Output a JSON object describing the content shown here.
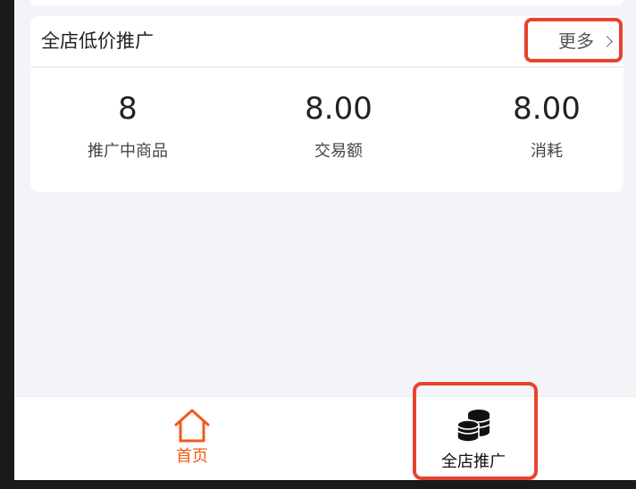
{
  "card": {
    "title": "全店低价推广",
    "more_label": "更多"
  },
  "stats": [
    {
      "value": "8",
      "label": "推广中商品"
    },
    {
      "value": "8.00",
      "label": "交易额"
    },
    {
      "value": "8.00",
      "label": "消耗"
    }
  ],
  "tabbar": {
    "home_label": "首页",
    "promo_label": "全店推广"
  },
  "colors": {
    "accent": "#f05a1a",
    "highlight": "#e8432f",
    "background": "#f4f4f8"
  },
  "icons": {
    "home": "home-icon",
    "promo": "coins-icon",
    "more": "chevron-right-icon"
  }
}
